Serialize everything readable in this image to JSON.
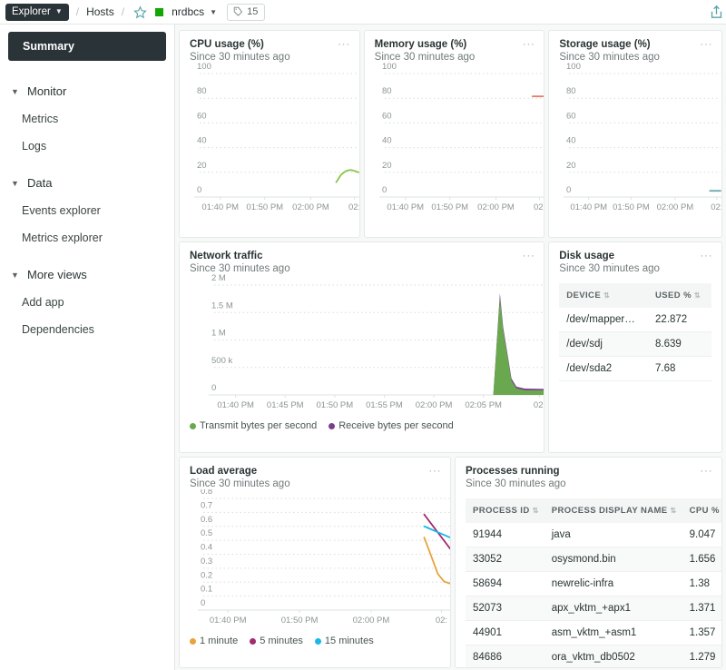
{
  "topbar": {
    "explorer_label": "Explorer",
    "caret": "⌄",
    "sep": "/",
    "hosts_label": "Hosts",
    "star_icon": "star-outline-icon",
    "status_color": "#11a600",
    "host_name": "nrdbcs",
    "tag_count": "15",
    "tag_icon": "tag-icon",
    "share_icon": "share-icon"
  },
  "sidebar": {
    "active_label": "Summary",
    "groups": [
      {
        "label": "Monitor",
        "items": [
          "Metrics",
          "Logs"
        ]
      },
      {
        "label": "Data",
        "items": [
          "Events explorer",
          "Metrics explorer"
        ]
      },
      {
        "label": "More views",
        "items": [
          "Add app",
          "Dependencies"
        ]
      }
    ]
  },
  "kebab_label": "···",
  "cards": {
    "cpu": {
      "title": "CPU usage (%)",
      "subtitle": "Since 30 minutes ago"
    },
    "memory": {
      "title": "Memory usage (%)",
      "subtitle": "Since 30 minutes ago"
    },
    "storage": {
      "title": "Storage usage (%)",
      "subtitle": "Since 30 minutes ago"
    },
    "network": {
      "title": "Network traffic",
      "subtitle": "Since 30 minutes ago"
    },
    "disk": {
      "title": "Disk usage",
      "subtitle": "Since 30 minutes ago"
    },
    "load": {
      "title": "Load average",
      "subtitle": "Since 30 minutes ago"
    },
    "processes": {
      "title": "Processes running",
      "subtitle": "Since 30 minutes ago"
    }
  },
  "chart_data": [
    {
      "id": "cpu",
      "type": "line",
      "title": "CPU usage (%)",
      "subtitle": "Since 30 minutes ago",
      "ylabel": "",
      "xlabel": "",
      "ylim": [
        0,
        100
      ],
      "yticks": [
        "0",
        "20",
        "40",
        "60",
        "80",
        "100"
      ],
      "xticks": [
        "01:40 PM",
        "01:50 PM",
        "02:00 PM",
        "02:"
      ],
      "grid": true,
      "series": [
        {
          "name": "CPU usage",
          "color": "#8bc34a",
          "x": [
            0.86,
            0.89,
            0.92,
            0.95,
            0.98,
            1.0
          ],
          "values": [
            12,
            18,
            21,
            22,
            21,
            20
          ]
        }
      ]
    },
    {
      "id": "memory",
      "type": "line",
      "title": "Memory usage (%)",
      "subtitle": "Since 30 minutes ago",
      "ylim": [
        0,
        100
      ],
      "yticks": [
        "0",
        "20",
        "40",
        "60",
        "80",
        "100"
      ],
      "xticks": [
        "01:40 PM",
        "01:50 PM",
        "02:00 PM",
        "02:"
      ],
      "grid": true,
      "series": [
        {
          "name": "Memory usage",
          "color": "#ec7963",
          "x": [
            0.93,
            1.0
          ],
          "values": [
            81.5,
            81.5
          ]
        }
      ]
    },
    {
      "id": "storage",
      "type": "line",
      "title": "Storage usage (%)",
      "subtitle": "Since 30 minutes ago",
      "ylim": [
        0,
        100
      ],
      "yticks": [
        "0",
        "20",
        "40",
        "60",
        "80",
        "100"
      ],
      "xticks": [
        "01:40 PM",
        "01:50 PM",
        "02:00 PM",
        "02:"
      ],
      "grid": true,
      "series": [
        {
          "name": "Storage usage",
          "color": "#6dacb0",
          "x": [
            0.93,
            1.0
          ],
          "values": [
            5,
            5
          ]
        }
      ]
    },
    {
      "id": "network",
      "type": "area",
      "title": "Network traffic",
      "subtitle": "Since 30 minutes ago",
      "ylim": [
        0,
        2000000
      ],
      "yticks": [
        "0",
        "500 k",
        "1 M",
        "1.5 M",
        "2 M"
      ],
      "xticks": [
        "01:40 PM",
        "01:45 PM",
        "01:50 PM",
        "01:55 PM",
        "02:00 PM",
        "02:05 PM",
        "02:"
      ],
      "grid": true,
      "legend_position": "bottom",
      "series": [
        {
          "name": "Transmit bytes per second",
          "color": "#6aa84f",
          "x": [
            0.845,
            0.865,
            0.875,
            0.9,
            0.915,
            0.94,
            1.0
          ],
          "values": [
            0,
            1780000,
            1180000,
            260000,
            120000,
            85000,
            85000
          ]
        },
        {
          "name": "Receive bytes per second",
          "color": "#7c3d8c",
          "x": [
            0.845,
            0.865,
            0.875,
            0.9,
            0.915,
            0.94,
            1.0
          ],
          "values": [
            0,
            1850000,
            1230000,
            300000,
            150000,
            115000,
            110000
          ]
        }
      ]
    },
    {
      "id": "load",
      "type": "line",
      "title": "Load average",
      "subtitle": "Since 30 minutes ago",
      "ylim": [
        0,
        0.8
      ],
      "yticks": [
        "0",
        "0.1",
        "0.2",
        "0.3",
        "0.4",
        "0.5",
        "0.6",
        "0.7",
        "0.8"
      ],
      "xticks": [
        "01:40 PM",
        "01:50 PM",
        "02:00 PM",
        "02:"
      ],
      "grid": true,
      "legend_position": "bottom",
      "series": [
        {
          "name": "1 minute",
          "color": "#e8a33d",
          "x": [
            0.895,
            0.925,
            0.95,
            0.975,
            1.0
          ],
          "values": [
            0.52,
            0.38,
            0.26,
            0.205,
            0.19
          ]
        },
        {
          "name": "5 minutes",
          "color": "#a32a6d",
          "x": [
            0.895,
            1.0
          ],
          "values": [
            0.685,
            0.44
          ]
        },
        {
          "name": "15 minutes",
          "color": "#1ab7ea",
          "x": [
            0.895,
            1.0
          ],
          "values": [
            0.6,
            0.52
          ]
        }
      ]
    },
    {
      "id": "disk",
      "type": "table",
      "title": "Disk usage",
      "subtitle": "Since 30 minutes ago",
      "columns": [
        "DEVICE",
        "USED %"
      ],
      "rows": [
        [
          "/dev/mapper…",
          "22.872"
        ],
        [
          "/dev/sdj",
          "8.639"
        ],
        [
          "/dev/sda2",
          "7.68"
        ]
      ]
    },
    {
      "id": "processes",
      "type": "table",
      "title": "Processes running",
      "subtitle": "Since 30 minutes ago",
      "columns": [
        "PROCESS ID",
        "PROCESS DISPLAY NAME",
        "CPU %"
      ],
      "rows": [
        [
          "91944",
          "java",
          "9.047"
        ],
        [
          "33052",
          "osysmond.bin",
          "1.656"
        ],
        [
          "58694",
          "newrelic-infra",
          "1.38"
        ],
        [
          "52073",
          "apx_vktm_+apx1",
          "1.371"
        ],
        [
          "44901",
          "asm_vktm_+asm1",
          "1.357"
        ],
        [
          "84686",
          "ora_vktm_db0502",
          "1.279"
        ]
      ]
    }
  ]
}
